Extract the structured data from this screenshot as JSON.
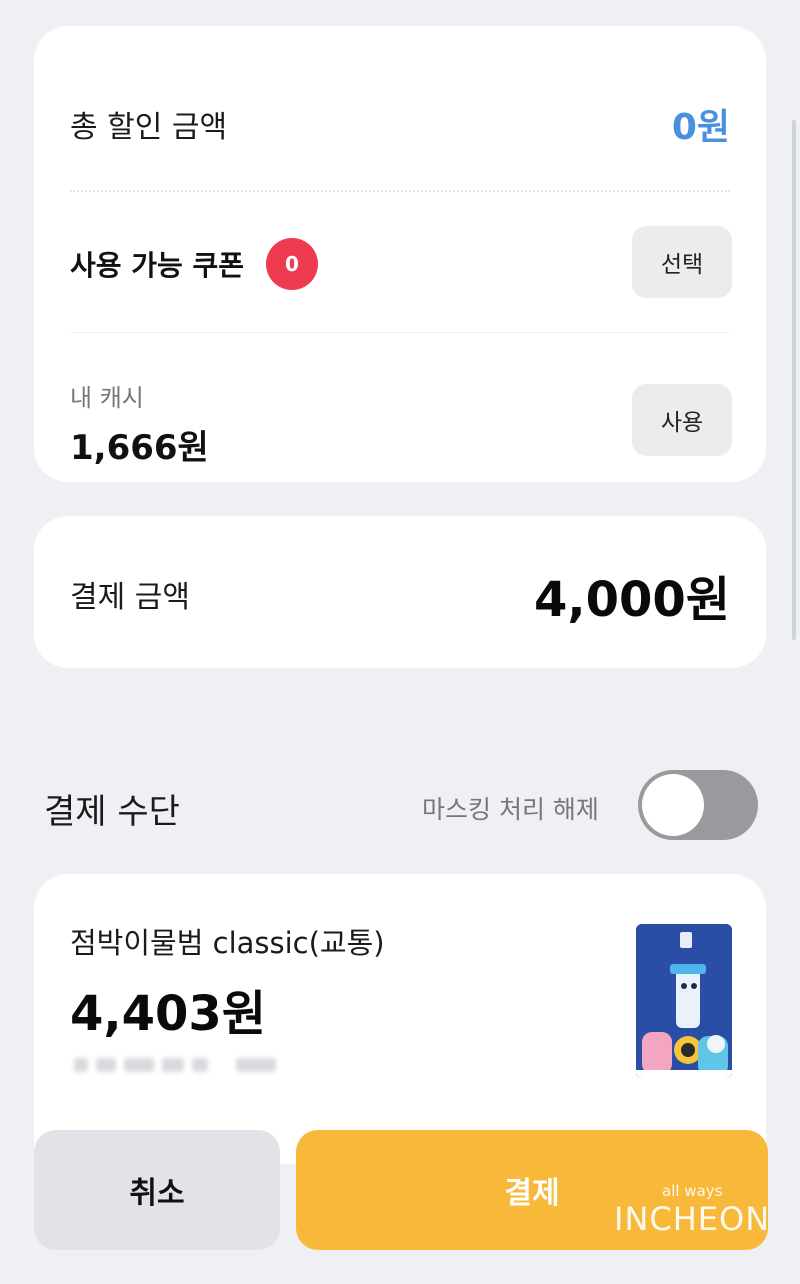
{
  "discount": {
    "total_label": "총 할인 금액",
    "total_value": "0원",
    "coupon_label": "사용 가능 쿠폰",
    "coupon_count": "0",
    "coupon_button": "선택",
    "cash_label": "내 캐시",
    "cash_value": "1,666원",
    "cash_button": "사용"
  },
  "payment": {
    "label": "결제 금액",
    "value": "4,000원"
  },
  "method": {
    "title": "결제 수단",
    "mask_label": "마스킹 처리 해제",
    "mask_toggle_on": false,
    "card_name": "점박이물범 classic(교통)",
    "card_balance": "4,403원",
    "card_image_icon": "transit-card-image"
  },
  "actions": {
    "cancel": "취소",
    "pay": "결제"
  },
  "watermark": {
    "small": "all ways",
    "big": "INCHEON"
  },
  "colors": {
    "accent_blue": "#4a8fe0",
    "badge_red": "#ef3b4f",
    "pay_button": "#f8b83a",
    "toggle_off": "#9a9a9e"
  }
}
